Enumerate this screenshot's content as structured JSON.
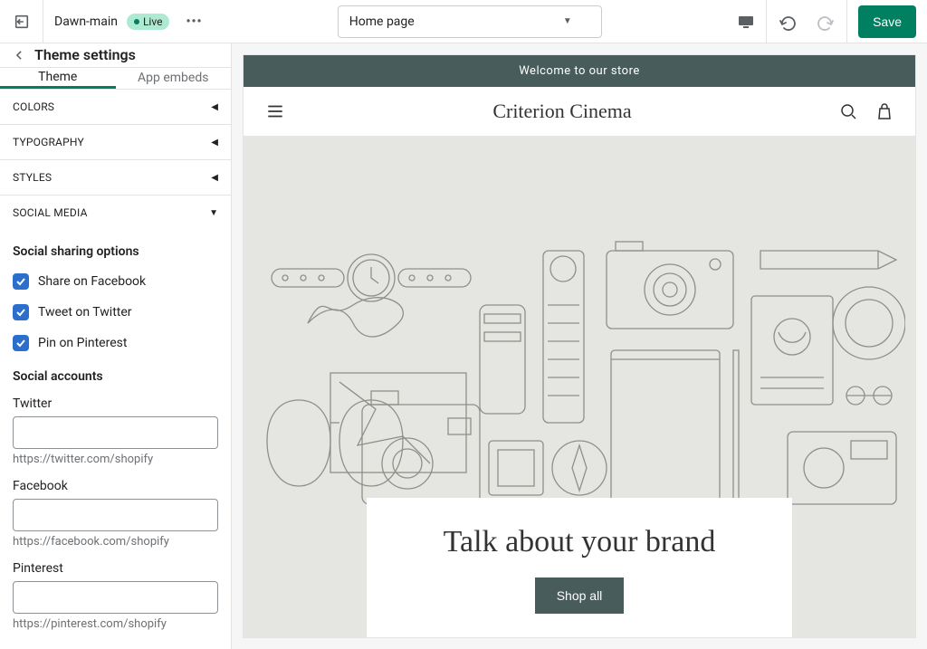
{
  "topbar": {
    "theme_name": "Dawn-main",
    "status": "Live",
    "page_select": "Home page",
    "save_label": "Save"
  },
  "sidebar": {
    "title": "Theme settings",
    "tabs": [
      "Theme",
      "App embeds"
    ],
    "sections": {
      "colors": "COLORS",
      "typography": "TYPOGRAPHY",
      "styles": "STYLES",
      "social_media": "SOCIAL MEDIA"
    },
    "social": {
      "sharing_heading": "Social sharing options",
      "share_facebook": "Share on Facebook",
      "tweet_twitter": "Tweet on Twitter",
      "pin_pinterest": "Pin on Pinterest",
      "accounts_heading": "Social accounts",
      "twitter_label": "Twitter",
      "twitter_value": "",
      "twitter_hint": "https://twitter.com/shopify",
      "facebook_label": "Facebook",
      "facebook_value": "",
      "facebook_hint": "https://facebook.com/shopify",
      "pinterest_label": "Pinterest",
      "pinterest_value": "",
      "pinterest_hint": "https://pinterest.com/shopify"
    }
  },
  "preview": {
    "announcement": "Welcome to our store",
    "store_name": "Criterion Cinema",
    "hero_heading": "Talk about your brand",
    "cta_label": "Shop all"
  }
}
